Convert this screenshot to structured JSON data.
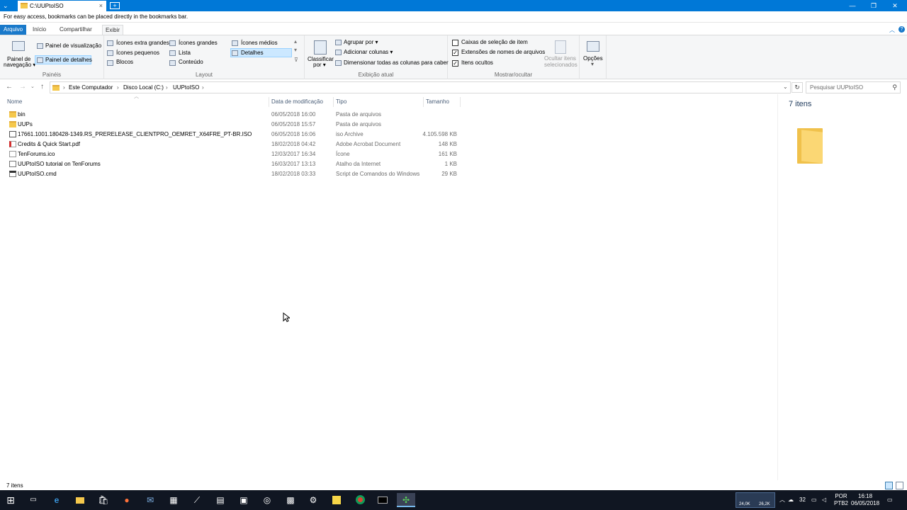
{
  "window": {
    "tab_title": "C:\\UUPtoISO",
    "close_tab": "×",
    "new_tab": "+",
    "minimize": "—",
    "maximize": "❐",
    "close": "✕"
  },
  "bookmarks_bar": {
    "message": "For easy access, bookmarks can be placed directly in the bookmarks bar."
  },
  "ribbon_tabs": [
    "Arquivo",
    "Início",
    "Compartilhar",
    "Exibir"
  ],
  "ribbon": {
    "paineis": {
      "title": "Painéis",
      "nav_pane": "Painel de navegação",
      "nav_pane_l1": "Painel de",
      "nav_pane_l2": "navegação ▾",
      "preview": "Painel de visualização",
      "details": "Painel de detalhes"
    },
    "layout": {
      "title": "Layout",
      "items": [
        "Ícones extra grandes",
        "Ícones grandes",
        "Ícones médios",
        "Ícones pequenos",
        "Lista",
        "Detalhes",
        "Blocos",
        "Conteúdo"
      ],
      "selected": "Detalhes"
    },
    "exibicao": {
      "title": "Exibição atual",
      "sort_l1": "Classificar",
      "sort_l2": "por ▾",
      "group": "Agrupar por ▾",
      "add_cols": "Adicionar colunas ▾",
      "size_cols": "Dimensionar todas as colunas para caber"
    },
    "mostrar": {
      "title": "Mostrar/ocultar",
      "chk_item": "Caixas de seleção de item",
      "chk_ext": "Extensões de nomes de arquivos",
      "chk_hidden": "Itens ocultos",
      "hide_l1": "Ocultar itens",
      "hide_l2": "selecionados"
    },
    "opcoes": {
      "label": "Opções"
    }
  },
  "address": {
    "crumbs": [
      "Este Computador",
      "Disco Local (C:)",
      "UUPtoISO"
    ],
    "search_placeholder": "Pesquisar UUPtoISO"
  },
  "columns": {
    "name": "Nome",
    "date": "Data de modificação",
    "type": "Tipo",
    "size": "Tamanho"
  },
  "files": [
    {
      "name": "bin",
      "date": "06/05/2018 16:00",
      "type": "Pasta de arquivos",
      "size": "",
      "icon": "folder"
    },
    {
      "name": "UUPs",
      "date": "06/05/2018 15:57",
      "type": "Pasta de arquivos",
      "size": "",
      "icon": "folder"
    },
    {
      "name": "17661.1001.180428-1349.RS_PRERELEASE_CLIENTPRO_OEMRET_X64FRE_PT-BR.ISO",
      "date": "06/05/2018 16:06",
      "type": "iso Archive",
      "size": "4.105.598 KB",
      "icon": "iso"
    },
    {
      "name": "Credits & Quick Start.pdf",
      "date": "18/02/2018 04:42",
      "type": "Adobe Acrobat Document",
      "size": "148 KB",
      "icon": "pdf"
    },
    {
      "name": "TenForums.ico",
      "date": "12/03/2017 16:34",
      "type": "Ícone",
      "size": "161 KB",
      "icon": "ico"
    },
    {
      "name": "UUPtoISO tutorial on TenForums",
      "date": "16/03/2017 13:13",
      "type": "Atalho da Internet",
      "size": "1 KB",
      "icon": "url"
    },
    {
      "name": "UUPtoISO.cmd",
      "date": "18/02/2018 03:33",
      "type": "Script de Comandos do Windows",
      "size": "29 KB",
      "icon": "cmd"
    }
  ],
  "details_pane": {
    "count": "7 itens"
  },
  "status": {
    "count": "7 itens"
  },
  "taskbar": {
    "net_down": "24,0K",
    "net_up": "26,2K",
    "temp": "32",
    "lang_l1": "POR",
    "lang_l2": "PTB2",
    "time": "16:18",
    "date": "06/05/2018"
  }
}
